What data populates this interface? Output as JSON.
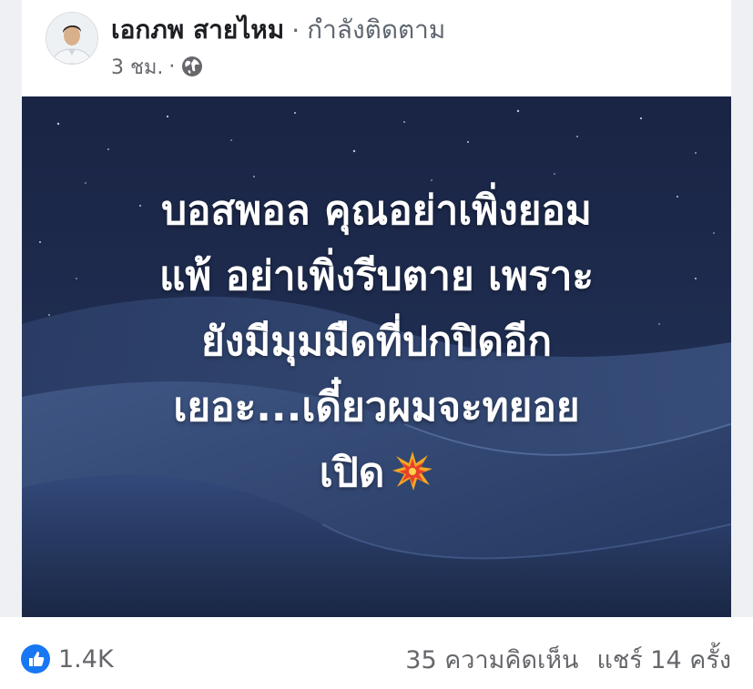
{
  "post": {
    "author": "เอกภพ สายไหม",
    "separator": "·",
    "follow_status": "กำลังติดตาม",
    "time": "3 ชม.",
    "meta_separator": "·",
    "privacy_icon": "globe-icon",
    "lines": [
      "บอสพอล คุณอย่าเพิ่งยอม",
      "แพ้ อย่าเพิ่งรีบตาย เพราะ",
      "ยังมีมุมมืดที่ปกปิดอีก",
      "เยอะ...เดี๋ยวผมจะทยอย",
      "เปิด"
    ],
    "emoji_icon": "collision-icon"
  },
  "footer": {
    "reaction_icon": "like-icon",
    "reaction_count": "1.4K",
    "comments": "35 ความคิดเห็น",
    "shares": "แชร์ 14 ครั้ง"
  },
  "colors": {
    "like_blue": "#1877f2",
    "text_primary": "#1c1e21",
    "text_secondary": "#65676b",
    "night_sky": "#16223f"
  }
}
